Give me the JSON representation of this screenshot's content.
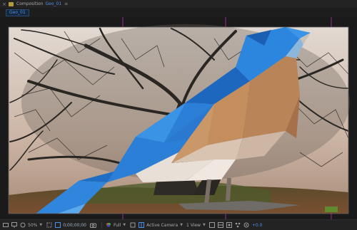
{
  "header": {
    "panel_label": "Composition",
    "comp_name": "Geo_01",
    "close_glyph": "×",
    "menu_glyph": "≡"
  },
  "tab": {
    "label": "Geo_01"
  },
  "viewer": {
    "subject": "low-poly bluebird on bare tree",
    "colors": {
      "sky": "#cbb8a8",
      "bird_blue": "#2c7fd6",
      "bird_orange": "#b98457",
      "bird_white": "#e6ddd6",
      "ground": "#6b4a2e",
      "branches": "#2a2723"
    }
  },
  "footer": {
    "zoom": "50%",
    "timecode": "0;00;00;00",
    "resolution": "Full",
    "camera": "Active Camera",
    "views": "1 View",
    "exposure": "+0.0",
    "icons": [
      "preview-icon",
      "monitor-icon",
      "mask-icon",
      "zoom-dropdown",
      "region-icon",
      "transparency-grid-icon",
      "timecode",
      "snapshot-icon",
      "channel-icon",
      "resolution-dropdown",
      "roi-icon",
      "grid-toggle-icon",
      "camera-dropdown",
      "views-dropdown",
      "toggle-icon",
      "3d-icon",
      "renderer-icon",
      "flowchart-icon",
      "exposure-reset-icon"
    ]
  }
}
